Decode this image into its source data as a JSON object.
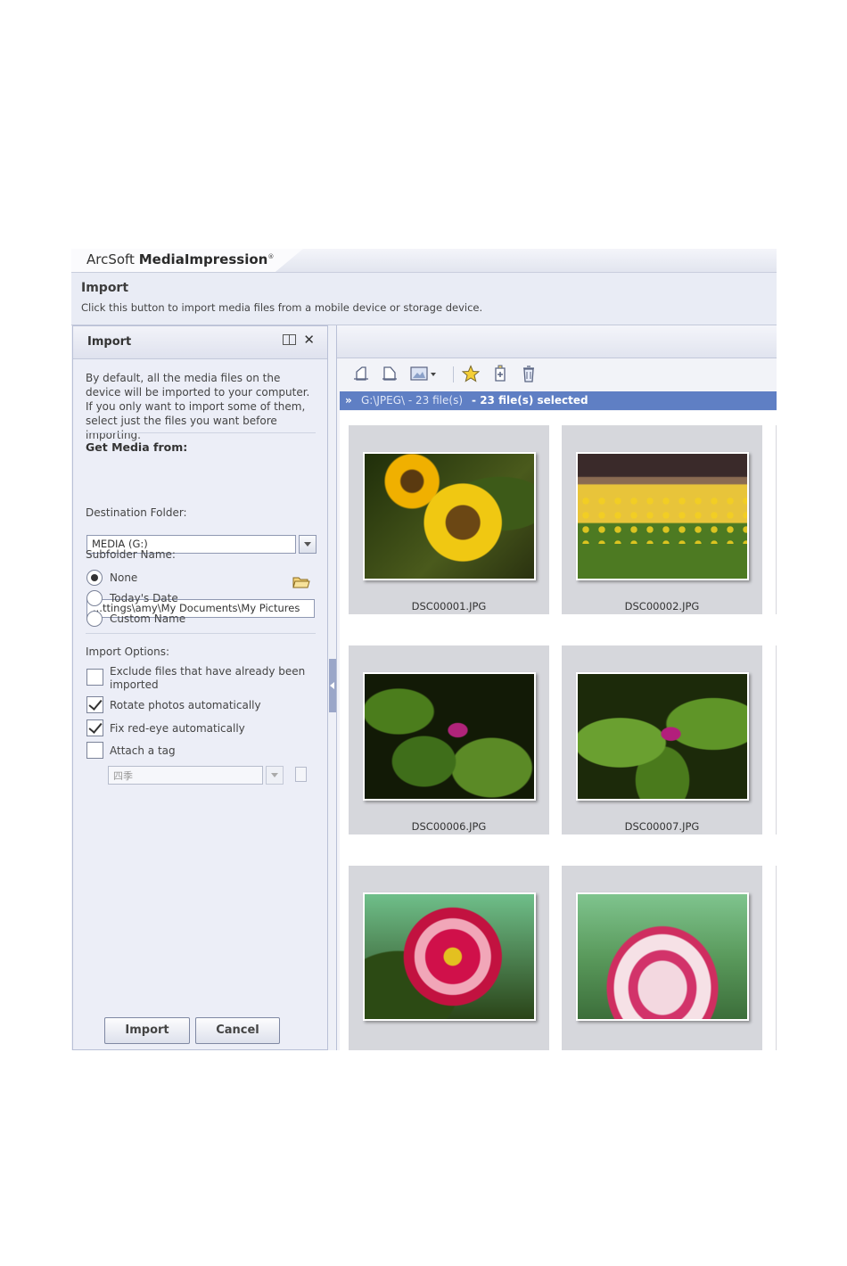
{
  "app": {
    "brand_prefix": "ArcSoft ",
    "brand_name": "MediaImpression",
    "brand_mark": "®"
  },
  "header": {
    "title": "Import",
    "description": "Click this button to import media files from a mobile device or storage device."
  },
  "import_panel": {
    "title": "Import",
    "intro": "By default, all the media files on the device will be imported to your computer. If you only want to import some of them, select just the files you want before importing.",
    "get_media_label": "Get Media from:",
    "get_media_value": "MEDIA (G:)",
    "destination_label": "Destination Folder:",
    "destination_value": "...ttings\\amy\\My Documents\\My Pictures",
    "subfolder_label": "Subfolder Name:",
    "subfolder_options": [
      {
        "label": "None",
        "selected": true
      },
      {
        "label": "Today's Date",
        "selected": false
      },
      {
        "label": "Custom Name",
        "selected": false
      }
    ],
    "options_label": "Import Options:",
    "options": [
      {
        "label": "Exclude files that have already been imported",
        "checked": false
      },
      {
        "label": "Rotate photos automatically",
        "checked": true
      },
      {
        "label": "Fix red-eye automatically",
        "checked": true
      },
      {
        "label": "Attach a tag",
        "checked": false
      }
    ],
    "tag_value": "四季",
    "import_button": "Import",
    "cancel_button": "Cancel"
  },
  "toolbar": {
    "icons": [
      "rotate-left-icon",
      "rotate-right-icon",
      "view-mode-icon",
      "star-icon",
      "tag-icon",
      "delete-icon"
    ]
  },
  "pathbar": {
    "path": "G:\\JPEG\\ - 23 file(s)",
    "selection": "- 23 file(s) selected"
  },
  "thumbnails": [
    {
      "name": "DSC00001.JPG",
      "subject": "sunflowers"
    },
    {
      "name": "DSC00002.JPG",
      "subject": "sunflower field"
    },
    {
      "name": "DSC00006.JPG",
      "subject": "pink bud"
    },
    {
      "name": "DSC00007.JPG",
      "subject": "pink bud"
    },
    {
      "name": "",
      "subject": "peony"
    },
    {
      "name": "",
      "subject": "peony"
    }
  ],
  "colors": {
    "pathbar": "#5f7fc4",
    "panel_bg": "#eceef7",
    "tile_bg": "#d6d7dc"
  }
}
